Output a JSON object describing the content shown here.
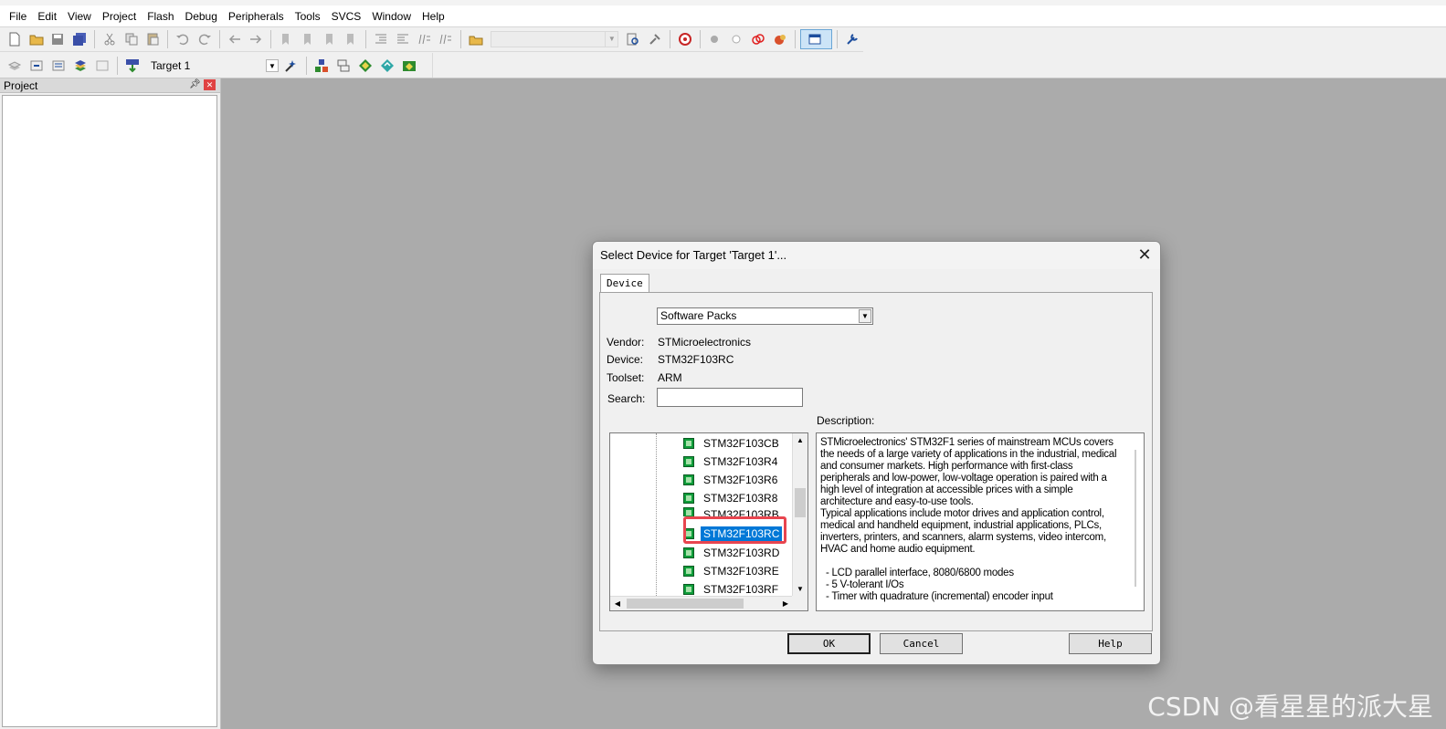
{
  "menu": [
    "File",
    "Edit",
    "View",
    "Project",
    "Flash",
    "Debug",
    "Peripherals",
    "Tools",
    "SVCS",
    "Window",
    "Help"
  ],
  "toolbar2": {
    "target": "Target 1"
  },
  "project_panel": {
    "title": "Project"
  },
  "dialog": {
    "title": "Select Device for Target 'Target 1'...",
    "tab": "Device",
    "pack_select": "Software Packs",
    "vendor_label": "Vendor:",
    "vendor": "STMicroelectronics",
    "device_label": "Device:",
    "device": "STM32F103RC",
    "toolset_label": "Toolset:",
    "toolset": "ARM",
    "search_label": "Search:",
    "search_value": "",
    "description_label": "Description:",
    "devices": [
      "STM32F103CB",
      "STM32F103R4",
      "STM32F103R6",
      "STM32F103R8",
      "STM32F103RB",
      "STM32F103RC",
      "STM32F103RD",
      "STM32F103RE",
      "STM32F103RF"
    ],
    "selected_device": "STM32F103RC",
    "description": [
      "STMicroelectronics' STM32F1 series of mainstream MCUs covers the needs of a large variety of applications in the industrial, medical and consumer markets. High performance with first-class peripherals and low-power, low-voltage operation is paired with a high level of integration at accessible prices with a simple architecture and easy-to-use tools.",
      "Typical applications include motor drives and application control, medical and handheld equipment, industrial applications, PLCs, inverters, printers, and scanners, alarm systems, video intercom, HVAC and home audio equipment.",
      "- LCD parallel interface, 8080/6800 modes",
      "- 5 V-tolerant I/Os",
      "- Timer with quadrature (incremental) encoder input"
    ],
    "buttons": {
      "ok": "OK",
      "cancel": "Cancel",
      "help": "Help"
    }
  },
  "watermark": "CSDN @看星星的派大星"
}
